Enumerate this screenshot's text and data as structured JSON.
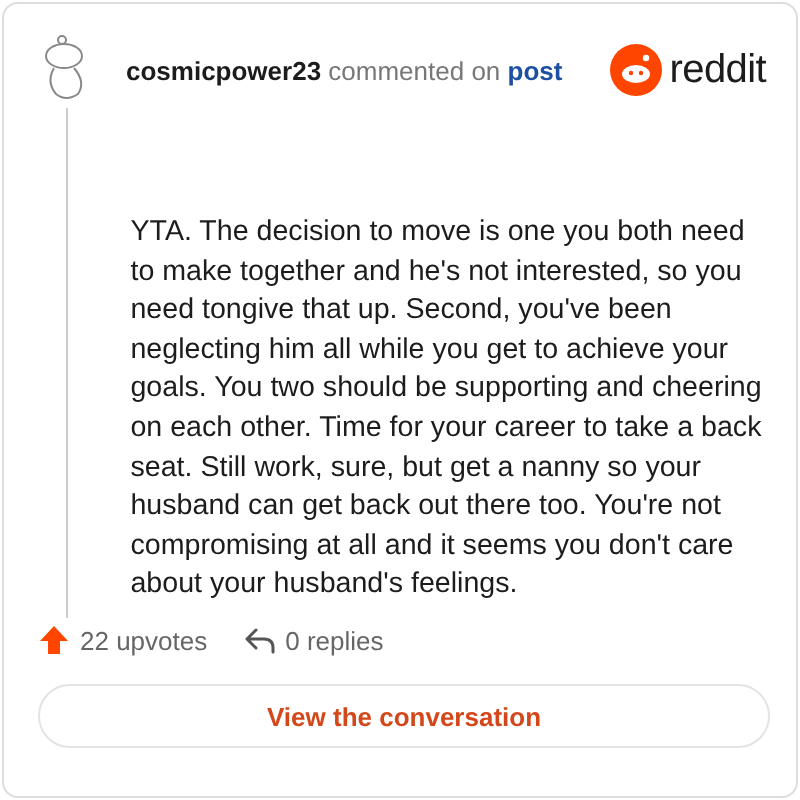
{
  "comment": {
    "author": "cosmicpower23",
    "action": "commented on",
    "target": "post",
    "brand": "reddit",
    "body": "YTA. The decision to move is one you both need to make together and he's not interested, so you need tongive that up. Second, you've been neglecting him all while you get to achieve your goals. You two should be supporting and cheering on each other. Time for your career to take a back seat. Still work, sure, but get a nanny so your husband can get back out there too. You're not compromising at all and it seems you don't care about your husband's feelings."
  },
  "stats": [
    {
      "kind": "upvotes",
      "label": "22 upvotes"
    },
    {
      "kind": "replies",
      "label": "0 replies"
    }
  ],
  "button": "View the conversation"
}
